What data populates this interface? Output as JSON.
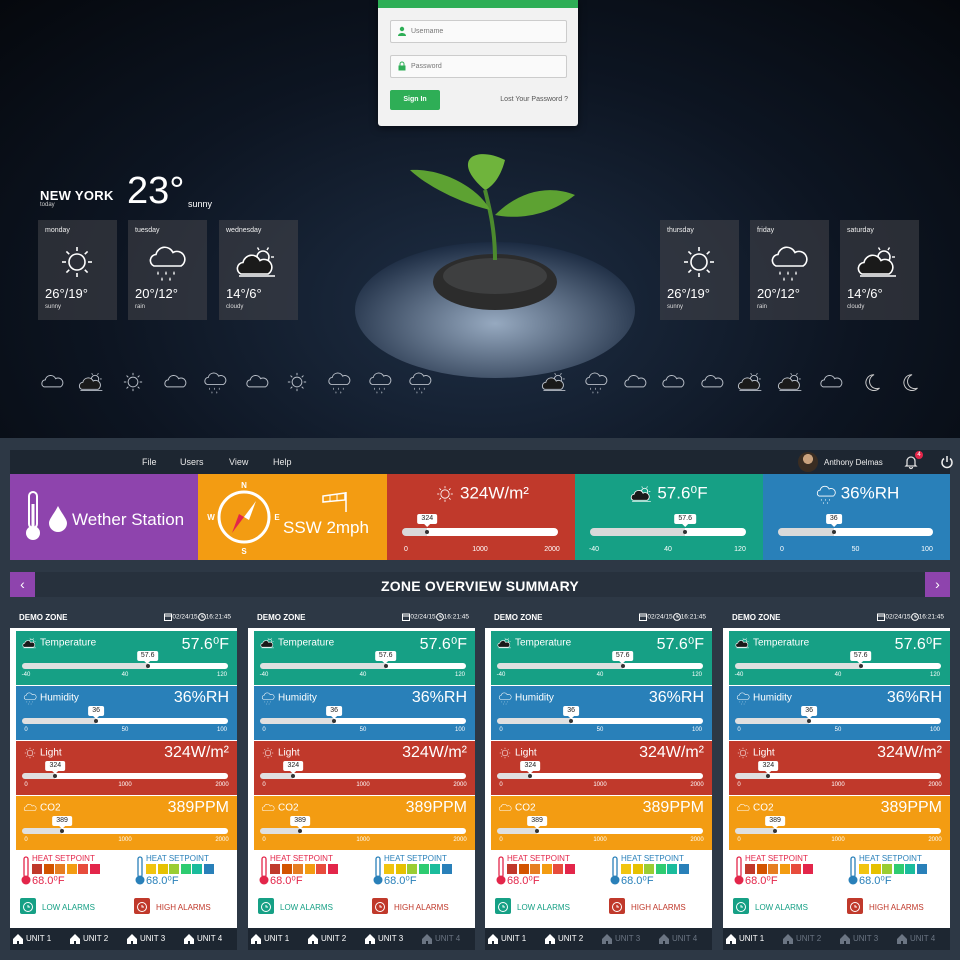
{
  "login": {
    "username_placeholder": "Username",
    "password_placeholder": "Password",
    "sign_in": "Sign In",
    "lost_password": "Lost Your Password ?",
    "accent": "#2eae56"
  },
  "weather": {
    "city": "NEW YORK",
    "today": "today",
    "temp": "23°",
    "condition": "sunny",
    "days": [
      {
        "name": "monday",
        "temp": "26°/19°",
        "cond": "sunny",
        "icon": "sun-icon"
      },
      {
        "name": "tuesday",
        "temp": "20°/12°",
        "cond": "rain",
        "icon": "rain-cloud-icon"
      },
      {
        "name": "wednesday",
        "temp": "14°/6°",
        "cond": "cloudy",
        "icon": "partly-cloudy-icon"
      },
      {
        "name": "thursday",
        "temp": "26°/19°",
        "cond": "sunny",
        "icon": "sun-icon"
      },
      {
        "name": "friday",
        "temp": "20°/12°",
        "cond": "rain",
        "icon": "rain-cloud-icon"
      },
      {
        "name": "saturday",
        "temp": "14°/6°",
        "cond": "cloudy",
        "icon": "partly-cloudy-icon"
      }
    ],
    "icon_set": [
      "cloud-icon",
      "partly-cloudy-icon",
      "sun-icon",
      "snow-cloud-icon",
      "rain-cloud-icon",
      "thunder-cloud-icon",
      "sunset-icon",
      "hail-cloud-icon",
      "rain-cloud-icon",
      "drizzle-cloud-icon",
      "partly-cloudy-rain-icon",
      "night-rain-icon",
      "night-snow-icon",
      "night-cloud-icon",
      "night-thunder-icon",
      "partly-sunny-icon",
      "night-partly-cloudy-icon",
      "snow-cloud-icon",
      "moon-icon",
      "crescent-moon-icon"
    ]
  },
  "menu": {
    "items": [
      "File",
      "Users",
      "View",
      "Help"
    ],
    "user": "Anthony Delmas",
    "notifications": "4"
  },
  "tiles": {
    "station": {
      "label": "Wether Station",
      "color": "#8e44ad"
    },
    "wind": {
      "label": "SSW 2mph",
      "color": "#f39c12",
      "compass": [
        "N",
        "E",
        "S",
        "W"
      ]
    },
    "light": {
      "label": "324W/m²",
      "value": "324",
      "ticks": [
        "0",
        "1000",
        "2000"
      ],
      "level": 0.162,
      "color": "#c0392b"
    },
    "temp": {
      "label": "57.6⁰F",
      "value": "57.6",
      "ticks": [
        "-40",
        "40",
        "120"
      ],
      "level": 0.61,
      "color": "#16a085"
    },
    "humid": {
      "label": "36%RH",
      "value": "36",
      "ticks": [
        "0",
        "50",
        "100"
      ],
      "level": 0.36,
      "color": "#2980b9"
    }
  },
  "zone_title": "ZONE OVERVIEW SUMMARY",
  "zone": {
    "name": "DEMO ZONE",
    "date": "02/24/15",
    "time": "16:21:45",
    "rows": {
      "temperature": {
        "label": "Temperature",
        "value": "57.6⁰F",
        "pill": "57.6",
        "ticks": [
          "-40",
          "40",
          "120"
        ],
        "level": 0.61,
        "color": "#16a085"
      },
      "humidity": {
        "label": "Humidity",
        "value": "36%RH",
        "pill": "36",
        "ticks": [
          "0",
          "50",
          "100"
        ],
        "level": 0.36,
        "color": "#2980b9"
      },
      "light": {
        "label": "Light",
        "value": "324W/m²",
        "pill": "324",
        "ticks": [
          "0",
          "1000",
          "2000"
        ],
        "level": 0.162,
        "color": "#c0392b"
      },
      "co2": {
        "label": "CO2",
        "value": "389PPM",
        "pill": "389",
        "ticks": [
          "0",
          "1000",
          "2000"
        ],
        "level": 0.1945,
        "color": "#f39c12"
      }
    },
    "heat": {
      "label": "HEAT SETPOINT",
      "value": "68.0⁰F",
      "color": "#e3264a"
    },
    "cool": {
      "label": "HEAT SETPOINT",
      "value": "68.0⁰F",
      "color": "#2980b9"
    },
    "low_alarm": "LOW ALARMS",
    "high_alarm": "HIGH ALARMS"
  },
  "unit_labels": [
    "UNIT 1",
    "UNIT 2",
    "UNIT 3",
    "UNIT 4"
  ],
  "zones_active_units": [
    4,
    3,
    2,
    1
  ]
}
